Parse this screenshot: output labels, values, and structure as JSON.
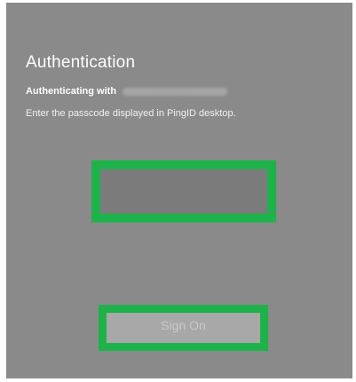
{
  "dialog": {
    "title": "Authentication",
    "authenticating_with_label": "Authenticating with",
    "authenticating_target": "",
    "instructions": "Enter the passcode displayed in PingID desktop."
  },
  "passcode_input": {
    "value": "",
    "placeholder": ""
  },
  "sign_on_button": {
    "label": "Sign On"
  },
  "colors": {
    "panel_background": "#8a8a8a",
    "highlight_border": "#1db34a",
    "input_background": "#7b7b7b",
    "button_background": "#a8a8a8",
    "button_text": "#c9c9c9"
  }
}
